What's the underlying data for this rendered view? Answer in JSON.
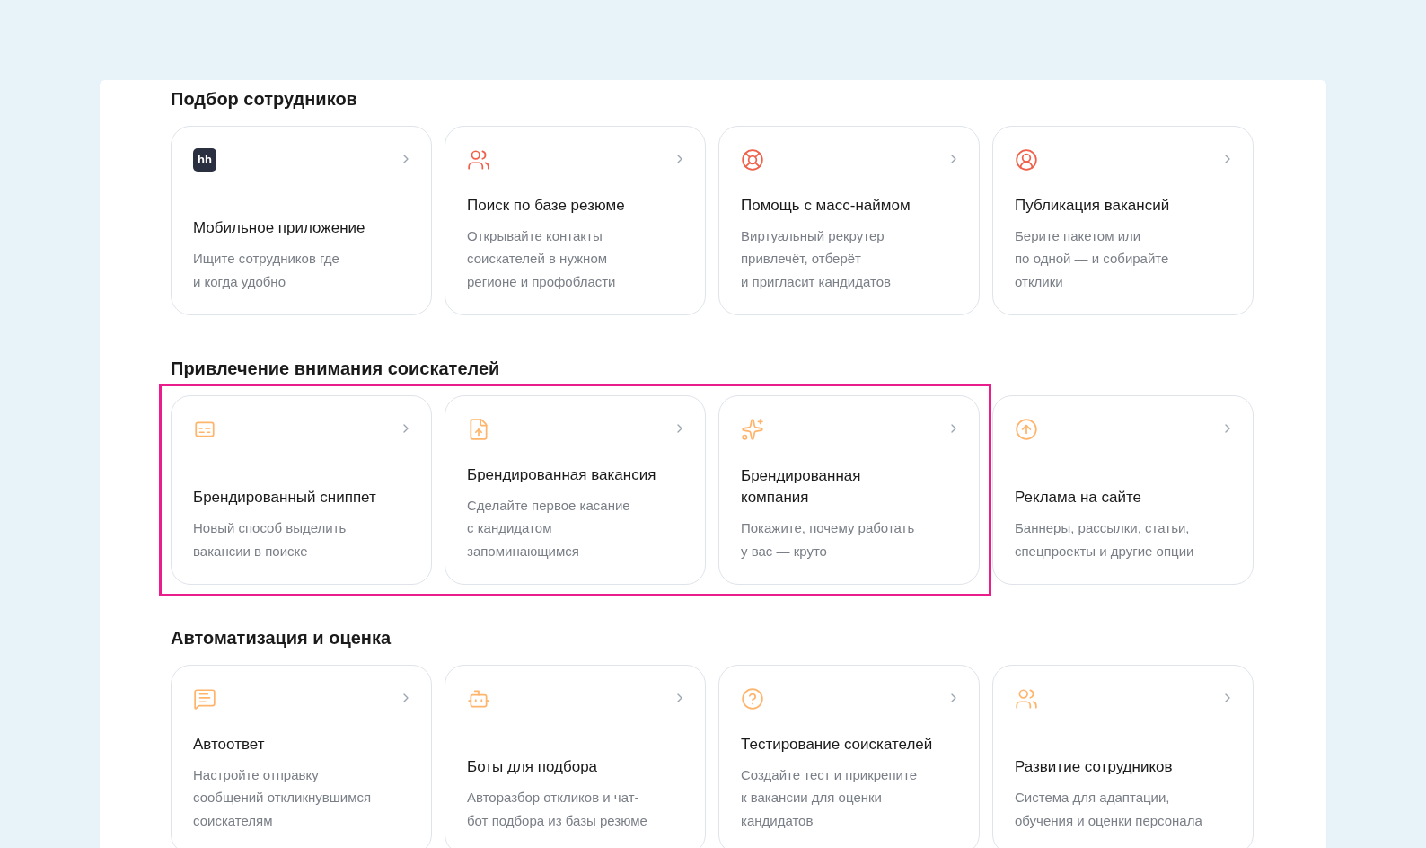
{
  "sections": [
    {
      "title": "Подбор сотрудников",
      "groups": [
        {
          "highlighted": false,
          "cards": [
            {
              "logo_text": "hh",
              "title": "Мобильное приложение",
              "description": "Ищите сотрудников где\nи когда удобно"
            },
            {
              "title": "Поиск по базе резюме",
              "description": "Открывайте контакты\nсоискателей в нужном\nрегионе и профобласти"
            },
            {
              "title": "Помощь с масс-наймом",
              "description": "Виртуальный рекрутер\nпривлечёт, отберёт\nи пригласит кандидатов"
            },
            {
              "title": "Публикация вакансий",
              "description": "Берите пакетом или\nпо одной — и собирайте\nотклики"
            }
          ]
        }
      ]
    },
    {
      "title": "Привлечение внимания соискателей",
      "groups": [
        {
          "highlighted": true,
          "cards": [
            {
              "title": "Брендированный сниппет",
              "description": "Новый способ выделить\nвакансии в поиске"
            },
            {
              "title": "Брендированная вакансия",
              "description": "Сделайте первое касание\nс кандидатом\nзапоминающимся"
            },
            {
              "title": "Брендированная\nкомпания",
              "description": "Покажите, почему работать\nу вас — круто"
            }
          ]
        },
        {
          "highlighted": false,
          "cards": [
            {
              "title": "Реклама на сайте",
              "description": "Баннеры, рассылки, статьи,\nспецпроекты и другие опции"
            }
          ]
        }
      ]
    },
    {
      "title": "Автоматизация и оценка",
      "groups": [
        {
          "highlighted": false,
          "cards": [
            {
              "title": "Автоответ",
              "description": "Настройте отправку\nсообщений откликнувшимся\nсоискателям"
            },
            {
              "title": "Боты для подбора",
              "description": "Авторазбор откликов и чат-\nбот подбора из базы резюме"
            },
            {
              "title": "Тестирование соискателей",
              "description": "Создайте тест и прикрепите\nк вакансии для оценки\nкандидатов"
            },
            {
              "title": "Развитие сотрудников",
              "description": "Система для адаптации,\nобучения и оценки персонала"
            }
          ]
        }
      ]
    }
  ]
}
